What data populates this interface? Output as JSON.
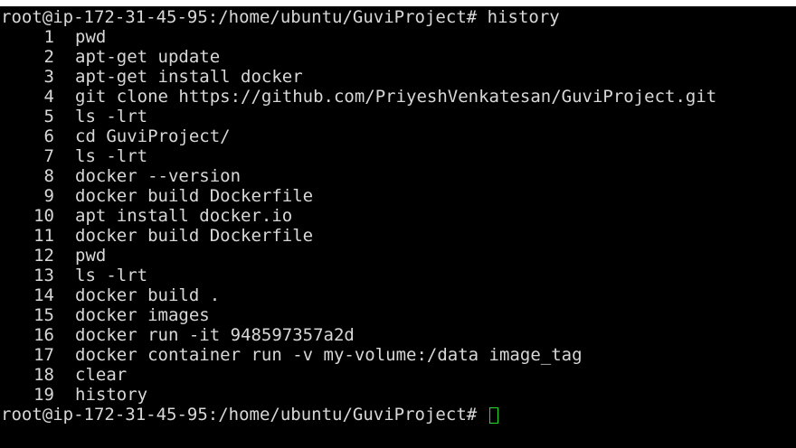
{
  "prompt": "root@ip-172-31-45-95:/home/ubuntu/GuviProject#",
  "first_command": "history",
  "history": [
    {
      "num": "1",
      "cmd": "pwd"
    },
    {
      "num": "2",
      "cmd": "apt-get update"
    },
    {
      "num": "3",
      "cmd": "apt-get install docker"
    },
    {
      "num": "4",
      "cmd": "git clone https://github.com/PriyeshVenkatesan/GuviProject.git"
    },
    {
      "num": "5",
      "cmd": "ls -lrt"
    },
    {
      "num": "6",
      "cmd": "cd GuviProject/"
    },
    {
      "num": "7",
      "cmd": "ls -lrt"
    },
    {
      "num": "8",
      "cmd": "docker --version"
    },
    {
      "num": "9",
      "cmd": "docker build Dockerfile"
    },
    {
      "num": "10",
      "cmd": "apt install docker.io"
    },
    {
      "num": "11",
      "cmd": "docker build Dockerfile"
    },
    {
      "num": "12",
      "cmd": "pwd"
    },
    {
      "num": "13",
      "cmd": "ls -lrt"
    },
    {
      "num": "14",
      "cmd": "docker build ."
    },
    {
      "num": "15",
      "cmd": "docker images"
    },
    {
      "num": "16",
      "cmd": "docker run -it 948597357a2d"
    },
    {
      "num": "17",
      "cmd": "docker container run -v my-volume:/data image_tag"
    },
    {
      "num": "18",
      "cmd": "clear"
    },
    {
      "num": "19",
      "cmd": "history"
    }
  ],
  "colors": {
    "background": "#000000",
    "text": "#d8d8d8",
    "cursor": "#22dd22"
  }
}
